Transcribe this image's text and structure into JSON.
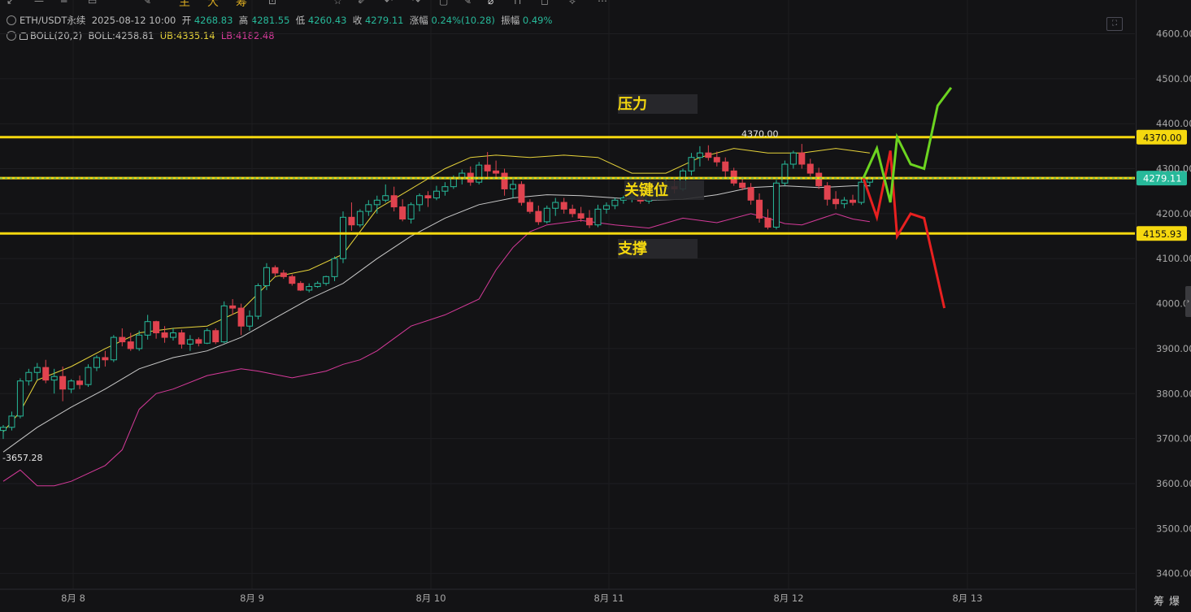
{
  "toolbar": {
    "labels": [
      "主",
      "大",
      "筹"
    ]
  },
  "header": {
    "symbol": "ETH/USDT永续",
    "datetime": "2025-08-12 10:00",
    "open_label": "开",
    "open": "4268.83",
    "high_label": "高",
    "high": "4281.55",
    "low_label": "低",
    "low": "4260.43",
    "close_label": "收",
    "close": "4279.11",
    "change_label": "涨幅",
    "change": "0.24%(10.28)",
    "amplitude_label": "振幅",
    "amplitude": "0.49%"
  },
  "indicator": {
    "name": "BOLL(20,2)",
    "mid_label": "BOLL:",
    "mid": "4258.81",
    "ub_label": "UB:",
    "ub": "4335.14",
    "lb_label": "LB:",
    "lb": "4182.48"
  },
  "colors": {
    "background": "#131315",
    "up": "#27b99a",
    "down": "#e0434f",
    "boll_mid": "#c9c9c9",
    "boll_ub": "#e8d43a",
    "boll_lb": "#d63a9a",
    "level_line": "#f5d80f",
    "projection_up": "#6cd420",
    "projection_down": "#e82020"
  },
  "bottom_tools": [
    "筹",
    "爆"
  ],
  "chart_data": {
    "type": "candlestick",
    "title": "",
    "y_axis": {
      "ticks": [
        "4600.00",
        "4500.00",
        "4400.00",
        "4300.00",
        "4200.00",
        "4100.00",
        "4000.00",
        "3900.00",
        "3800.00",
        "3700.00",
        "3600.00",
        "3500.00",
        "3400.00"
      ],
      "range": [
        3365,
        4675
      ]
    },
    "x_axis": {
      "ticks": [
        "8月 8",
        "8月 9",
        "8月 10",
        "8月 11",
        "8月 12",
        "8月 13"
      ],
      "range": [
        0,
        60
      ]
    },
    "x_tick_index": [
      0,
      10,
      20,
      30,
      40,
      50
    ],
    "grid": true,
    "levels": [
      {
        "name": "压力",
        "price": 4370,
        "label": "4370.00"
      },
      {
        "name": "关键位",
        "price": 4279.11,
        "label": "4279.11",
        "current": true
      },
      {
        "name": "支撑",
        "price": 4155.93,
        "label": "4155.93"
      }
    ],
    "annotations": {
      "high_label": "4370.00",
      "low_label": "3657.28"
    },
    "candles": [
      [
        3718,
        3730,
        3699,
        3725
      ],
      [
        3725,
        3760,
        3718,
        3750
      ],
      [
        3750,
        3834,
        3745,
        3828
      ],
      [
        3828,
        3855,
        3818,
        3847
      ],
      [
        3847,
        3868,
        3830,
        3858
      ],
      [
        3858,
        3875,
        3823,
        3830
      ],
      [
        3830,
        3855,
        3800,
        3838
      ],
      [
        3838,
        3860,
        3783,
        3810
      ],
      [
        3810,
        3832,
        3801,
        3828
      ],
      [
        3828,
        3840,
        3810,
        3820
      ],
      [
        3820,
        3865,
        3815,
        3858
      ],
      [
        3858,
        3885,
        3850,
        3880
      ],
      [
        3880,
        3895,
        3860,
        3875
      ],
      [
        3875,
        3930,
        3870,
        3925
      ],
      [
        3925,
        3945,
        3905,
        3915
      ],
      [
        3915,
        3935,
        3895,
        3900
      ],
      [
        3900,
        3940,
        3895,
        3930
      ],
      [
        3930,
        3975,
        3920,
        3960
      ],
      [
        3960,
        3962,
        3922,
        3935
      ],
      [
        3935,
        3950,
        3913,
        3925
      ],
      [
        3925,
        3945,
        3918,
        3935
      ],
      [
        3935,
        3942,
        3900,
        3910
      ],
      [
        3910,
        3930,
        3895,
        3920
      ],
      [
        3920,
        3925,
        3905,
        3912
      ],
      [
        3912,
        3945,
        3910,
        3940
      ],
      [
        3940,
        3945,
        3910,
        3915
      ],
      [
        3915,
        4005,
        3912,
        3995
      ],
      [
        3995,
        4010,
        3975,
        3990
      ],
      [
        3990,
        4000,
        3930,
        3950
      ],
      [
        3950,
        3985,
        3940,
        3972
      ],
      [
        3972,
        4045,
        3965,
        4040
      ],
      [
        4040,
        4090,
        4030,
        4080
      ],
      [
        4080,
        4085,
        4060,
        4068
      ],
      [
        4068,
        4075,
        4055,
        4060
      ],
      [
        4060,
        4065,
        4040,
        4045
      ],
      [
        4045,
        4050,
        4028,
        4030
      ],
      [
        4030,
        4045,
        4025,
        4038
      ],
      [
        4038,
        4050,
        4035,
        4045
      ],
      [
        4045,
        4062,
        4040,
        4060
      ],
      [
        4060,
        4105,
        4050,
        4100
      ],
      [
        4100,
        4205,
        4090,
        4192
      ],
      [
        4192,
        4225,
        4162,
        4175
      ],
      [
        4175,
        4210,
        4170,
        4205
      ],
      [
        4205,
        4230,
        4195,
        4220
      ],
      [
        4220,
        4240,
        4200,
        4230
      ],
      [
        4230,
        4265,
        4225,
        4240
      ],
      [
        4240,
        4260,
        4205,
        4215
      ],
      [
        4215,
        4232,
        4183,
        4188
      ],
      [
        4188,
        4225,
        4178,
        4220
      ],
      [
        4220,
        4245,
        4205,
        4240
      ],
      [
        4240,
        4250,
        4215,
        4235
      ],
      [
        4235,
        4262,
        4230,
        4250
      ],
      [
        4250,
        4270,
        4240,
        4260
      ],
      [
        4260,
        4285,
        4255,
        4278
      ],
      [
        4278,
        4298,
        4265,
        4290
      ],
      [
        4290,
        4305,
        4262,
        4270
      ],
      [
        4270,
        4315,
        4265,
        4308
      ],
      [
        4308,
        4337,
        4282,
        4295
      ],
      [
        4295,
        4318,
        4280,
        4290
      ],
      [
        4290,
        4300,
        4240,
        4255
      ],
      [
        4255,
        4275,
        4235,
        4265
      ],
      [
        4265,
        4272,
        4218,
        4225
      ],
      [
        4225,
        4232,
        4200,
        4205
      ],
      [
        4205,
        4218,
        4175,
        4182
      ],
      [
        4182,
        4218,
        4178,
        4212
      ],
      [
        4212,
        4235,
        4195,
        4225
      ],
      [
        4225,
        4235,
        4200,
        4210
      ],
      [
        4210,
        4220,
        4192,
        4200
      ],
      [
        4200,
        4215,
        4182,
        4190
      ],
      [
        4190,
        4208,
        4168,
        4175
      ],
      [
        4175,
        4220,
        4170,
        4210
      ],
      [
        4210,
        4225,
        4200,
        4218
      ],
      [
        4218,
        4235,
        4210,
        4230
      ],
      [
        4230,
        4240,
        4222,
        4235
      ],
      [
        4235,
        4245,
        4225,
        4238
      ],
      [
        4238,
        4246,
        4222,
        4228
      ],
      [
        4228,
        4248,
        4222,
        4240
      ],
      [
        4240,
        4270,
        4230,
        4255
      ],
      [
        4255,
        4275,
        4240,
        4260
      ],
      [
        4260,
        4275,
        4245,
        4255
      ],
      [
        4255,
        4300,
        4250,
        4295
      ],
      [
        4295,
        4335,
        4285,
        4325
      ],
      [
        4325,
        4350,
        4305,
        4335
      ],
      [
        4335,
        4352,
        4318,
        4325
      ],
      [
        4325,
        4338,
        4305,
        4315
      ],
      [
        4315,
        4325,
        4280,
        4295
      ],
      [
        4295,
        4302,
        4262,
        4268
      ],
      [
        4268,
        4282,
        4252,
        4258
      ],
      [
        4258,
        4268,
        4220,
        4230
      ],
      [
        4230,
        4245,
        4180,
        4190
      ],
      [
        4190,
        4210,
        4165,
        4170
      ],
      [
        4170,
        4275,
        4165,
        4268
      ],
      [
        4268,
        4318,
        4262,
        4310
      ],
      [
        4310,
        4340,
        4300,
        4335
      ],
      [
        4335,
        4355,
        4300,
        4310
      ],
      [
        4310,
        4322,
        4283,
        4290
      ],
      [
        4290,
        4302,
        4255,
        4262
      ],
      [
        4262,
        4270,
        4218,
        4232
      ],
      [
        4232,
        4250,
        4210,
        4222
      ],
      [
        4222,
        4237,
        4212,
        4230
      ],
      [
        4230,
        4242,
        4218,
        4225
      ],
      [
        4225,
        4280,
        4220,
        4270
      ],
      [
        4270,
        4282,
        4260,
        4279
      ]
    ],
    "boll_mid": [
      [
        0,
        3670
      ],
      [
        4,
        3725
      ],
      [
        8,
        3770
      ],
      [
        12,
        3810
      ],
      [
        16,
        3855
      ],
      [
        20,
        3880
      ],
      [
        24,
        3895
      ],
      [
        28,
        3925
      ],
      [
        32,
        3968
      ],
      [
        36,
        4010
      ],
      [
        40,
        4045
      ],
      [
        44,
        4100
      ],
      [
        48,
        4150
      ],
      [
        52,
        4190
      ],
      [
        56,
        4220
      ],
      [
        60,
        4235
      ],
      [
        64,
        4242
      ],
      [
        68,
        4240
      ],
      [
        72,
        4235
      ],
      [
        76,
        4230
      ],
      [
        80,
        4232
      ],
      [
        84,
        4242
      ],
      [
        88,
        4258
      ],
      [
        92,
        4262
      ],
      [
        96,
        4258
      ],
      [
        100,
        4262
      ],
      [
        102,
        4262
      ]
    ],
    "boll_ub": [
      [
        0,
        3715
      ],
      [
        2,
        3760
      ],
      [
        4,
        3830
      ],
      [
        8,
        3860
      ],
      [
        12,
        3900
      ],
      [
        16,
        3935
      ],
      [
        20,
        3945
      ],
      [
        24,
        3950
      ],
      [
        28,
        3985
      ],
      [
        32,
        4060
      ],
      [
        36,
        4075
      ],
      [
        40,
        4110
      ],
      [
        44,
        4210
      ],
      [
        48,
        4255
      ],
      [
        52,
        4300
      ],
      [
        55,
        4325
      ],
      [
        58,
        4330
      ],
      [
        62,
        4325
      ],
      [
        66,
        4330
      ],
      [
        70,
        4325
      ],
      [
        74,
        4290
      ],
      [
        78,
        4290
      ],
      [
        82,
        4325
      ],
      [
        86,
        4345
      ],
      [
        90,
        4335
      ],
      [
        94,
        4335
      ],
      [
        98,
        4345
      ],
      [
        102,
        4335
      ]
    ],
    "boll_lb": [
      [
        0,
        3605
      ],
      [
        2,
        3630
      ],
      [
        4,
        3595
      ],
      [
        6,
        3595
      ],
      [
        8,
        3605
      ],
      [
        12,
        3640
      ],
      [
        14,
        3675
      ],
      [
        16,
        3765
      ],
      [
        18,
        3800
      ],
      [
        20,
        3810
      ],
      [
        24,
        3840
      ],
      [
        28,
        3855
      ],
      [
        30,
        3850
      ],
      [
        34,
        3835
      ],
      [
        38,
        3850
      ],
      [
        40,
        3865
      ],
      [
        42,
        3875
      ],
      [
        44,
        3895
      ],
      [
        48,
        3950
      ],
      [
        52,
        3975
      ],
      [
        56,
        4010
      ],
      [
        58,
        4075
      ],
      [
        60,
        4125
      ],
      [
        62,
        4160
      ],
      [
        64,
        4175
      ],
      [
        68,
        4185
      ],
      [
        72,
        4175
      ],
      [
        76,
        4168
      ],
      [
        80,
        4190
      ],
      [
        84,
        4180
      ],
      [
        88,
        4200
      ],
      [
        90,
        4190
      ],
      [
        92,
        4178
      ],
      [
        94,
        4175
      ],
      [
        98,
        4200
      ],
      [
        100,
        4188
      ],
      [
        102,
        4182
      ]
    ],
    "projection_up": [
      [
        103,
        4279
      ],
      [
        105,
        4345
      ],
      [
        107,
        4225
      ],
      [
        108,
        4370
      ],
      [
        110,
        4310
      ],
      [
        112,
        4300
      ],
      [
        114,
        4440
      ],
      [
        116,
        4480
      ]
    ],
    "projection_down": [
      [
        103,
        4279
      ],
      [
        105,
        4192
      ],
      [
        107,
        4340
      ],
      [
        108,
        4150
      ],
      [
        110,
        4200
      ],
      [
        112,
        4190
      ],
      [
        115,
        3990
      ]
    ],
    "x_index_axis": [
      0,
      116
    ]
  }
}
